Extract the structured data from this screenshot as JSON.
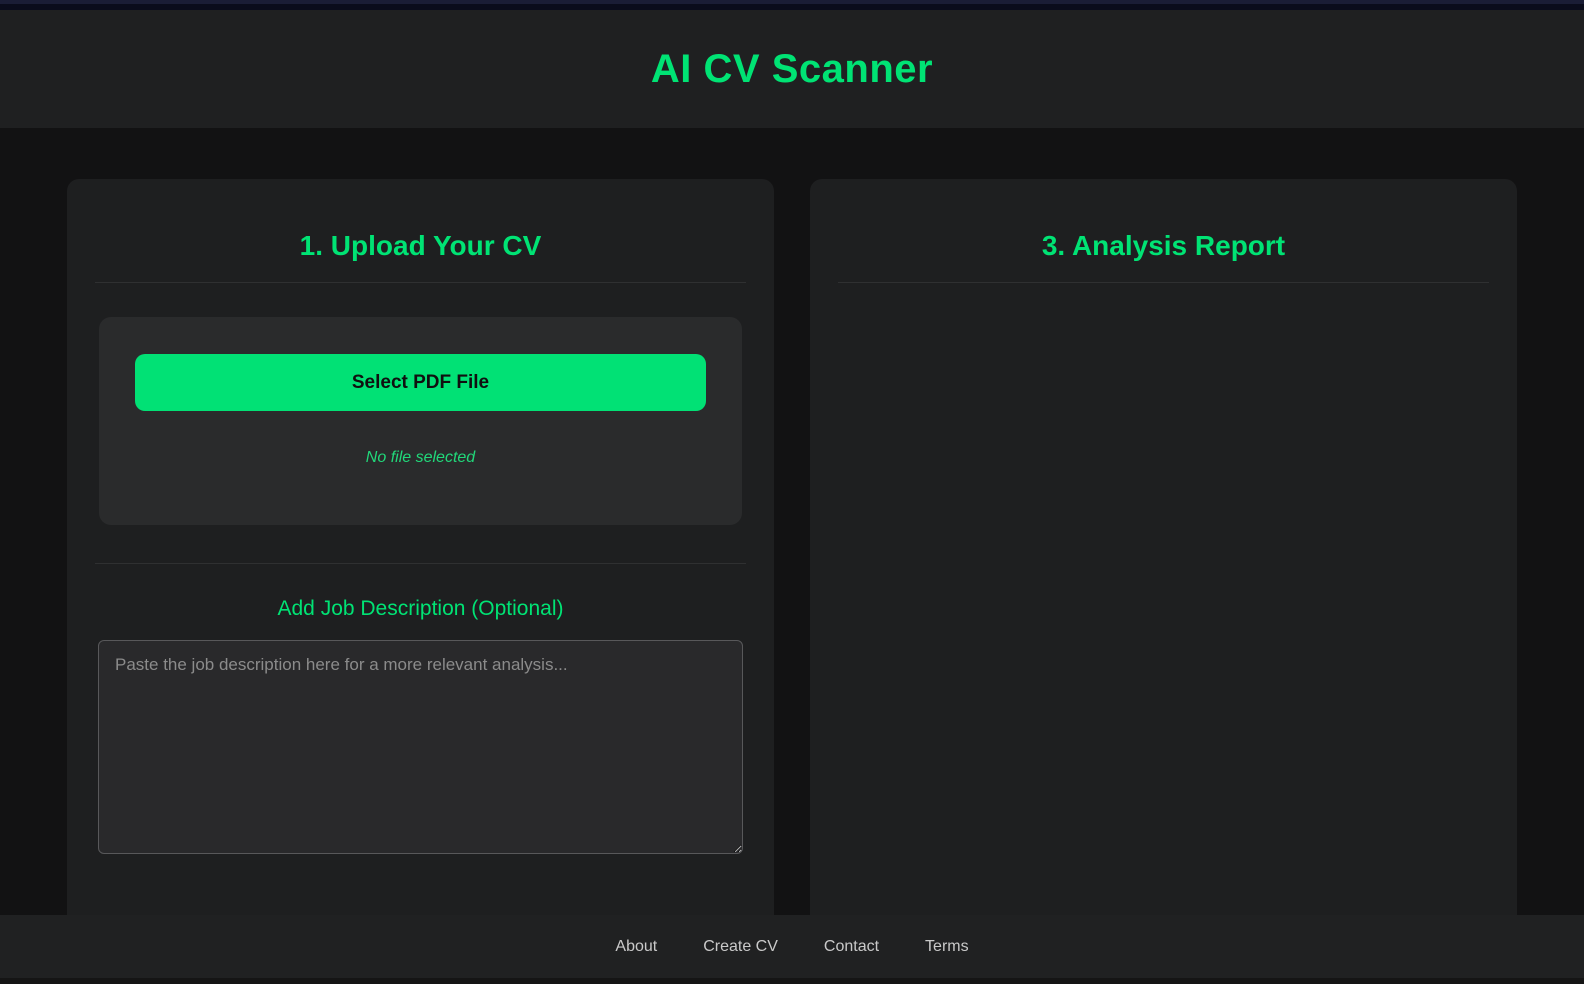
{
  "header": {
    "title": "AI CV Scanner"
  },
  "colors": {
    "accent_green": "#00e374",
    "button_green": "#01e175",
    "status_green": "#21d87a",
    "page_background": "#121213",
    "panel_background": "#1e1f20"
  },
  "upload_panel": {
    "heading": "1. Upload Your CV",
    "select_button_label": "Select PDF File",
    "file_status": "No file selected",
    "job_description_heading": "Add Job Description (Optional)",
    "job_description_placeholder": "Paste the job description here for a more relevant analysis...",
    "job_description_value": ""
  },
  "report_panel": {
    "heading": "3. Analysis Report"
  },
  "footer": {
    "links": [
      "About",
      "Create CV",
      "Contact",
      "Terms"
    ]
  }
}
